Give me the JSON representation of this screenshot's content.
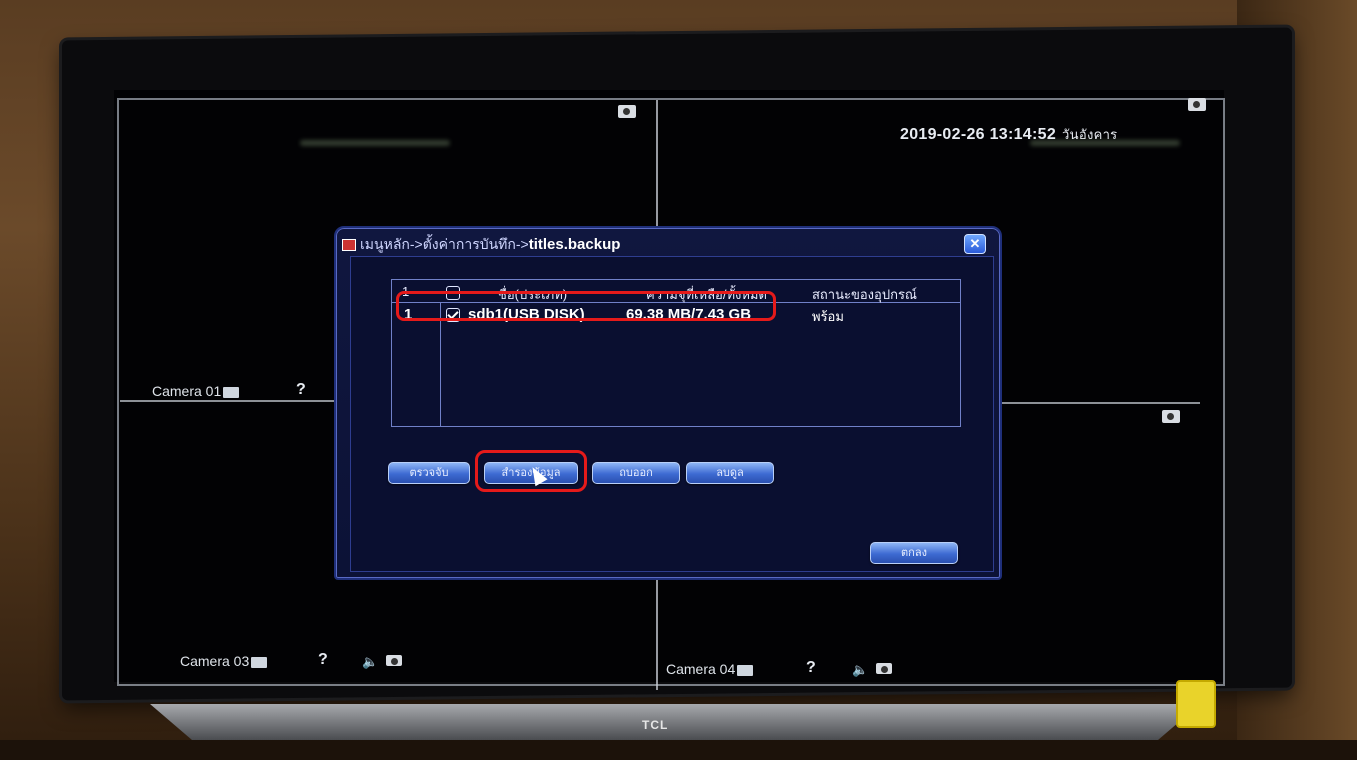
{
  "osd": {
    "datetime": "2019-02-26 13:14:52",
    "weekday": "วันอังคาร"
  },
  "cameras": {
    "cam1": "Camera 01",
    "cam3": "Camera 03",
    "cam4": "Camera 04",
    "unknown_symbol": "?"
  },
  "dialog": {
    "title_prefix": "เมนูหลัก->ตั้งค่าการบันทึก->",
    "title_bold": "titles.backup",
    "close": "✕",
    "table": {
      "headers": {
        "index": "1",
        "name": "ชื่อ(ประเภท)",
        "space": "ความจุที่เหลือ/ทั้งหมด",
        "status": "สถานะของอุปกรณ์"
      },
      "rows": [
        {
          "index": "1",
          "name": "sdb1(USB DISK)",
          "space": "69.38 MB/7.43 GB",
          "status": "พร้อม",
          "checked": true
        }
      ]
    },
    "buttons": {
      "detect": "ตรวจจับ",
      "backup": "สำรองข้อมูล",
      "burn": "ถบออก",
      "erase": "ลบดูล",
      "ok": "ตกลง"
    }
  },
  "tv": {
    "brand": "TCL"
  }
}
